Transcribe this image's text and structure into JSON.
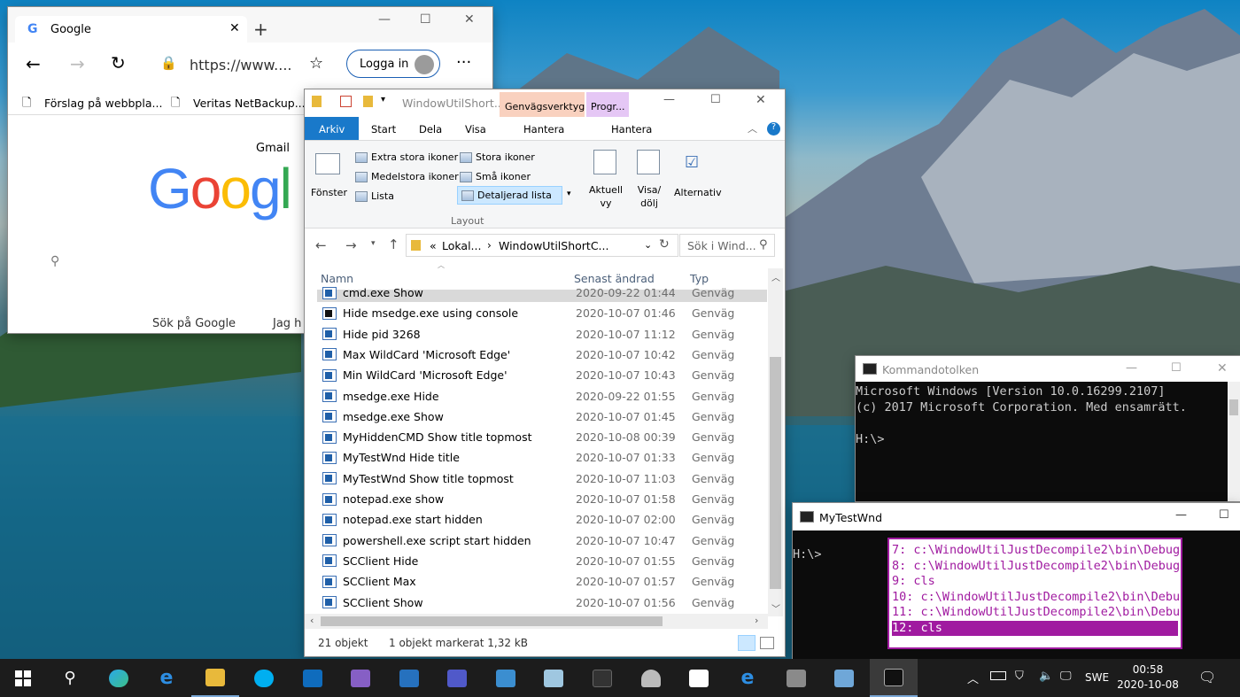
{
  "edge": {
    "tab_title": "Google",
    "address": "https://www....",
    "signin": "Logga in",
    "fav1": "Förslag på webbpla...",
    "fav2": "Veritas NetBackup...",
    "gmail": "Gmail",
    "search_btn": "Sök på Google",
    "lucky_btn": "Jag h",
    "logo": "Googl"
  },
  "explorer": {
    "qat_title": "WindowUtilShort...",
    "ctx_tab1": "Genvägsverktyg",
    "ctx_tab2": "Progr...",
    "tabs": [
      "Arkiv",
      "Start",
      "Dela",
      "Visa",
      "Hantera",
      "Hantera"
    ],
    "ribbon": {
      "pane": "Fönster",
      "xl": "Extra stora ikoner",
      "large": "Stora ikoner",
      "medium": "Medelstora ikoner",
      "small": "Små ikoner",
      "list": "Lista",
      "details": "Detaljerad lista",
      "group": "Layout",
      "current": "Aktuell vy",
      "showhide": "Visa/ dölj",
      "options": "Alternativ"
    },
    "crumb1": "Lokal...",
    "crumb2": "WindowUtilShortC...",
    "crumb_prefix": "«",
    "search_ph": "Sök i Wind...",
    "headers": {
      "name": "Namn",
      "date": "Senast ändrad",
      "type": "Typ"
    },
    "rows": [
      {
        "name": "cmd.exe Show",
        "date": "2020-09-22 01:44",
        "type": "Genväg"
      },
      {
        "name": "Hide msedge.exe using console",
        "date": "2020-10-07 01:46",
        "type": "Genväg"
      },
      {
        "name": "Hide pid 3268",
        "date": "2020-10-07 11:12",
        "type": "Genväg"
      },
      {
        "name": "Max WildCard 'Microsoft Edge'",
        "date": "2020-10-07 10:42",
        "type": "Genväg"
      },
      {
        "name": "Min WildCard 'Microsoft Edge'",
        "date": "2020-10-07 10:43",
        "type": "Genväg"
      },
      {
        "name": "msedge.exe Hide",
        "date": "2020-09-22 01:55",
        "type": "Genväg"
      },
      {
        "name": "msedge.exe Show",
        "date": "2020-10-07 01:45",
        "type": "Genväg"
      },
      {
        "name": "MyHiddenCMD Show title topmost",
        "date": "2020-10-08 00:39",
        "type": "Genväg"
      },
      {
        "name": "MyTestWnd Hide title",
        "date": "2020-10-07 01:33",
        "type": "Genväg"
      },
      {
        "name": "MyTestWnd Show title topmost",
        "date": "2020-10-07 11:03",
        "type": "Genväg"
      },
      {
        "name": "notepad.exe show",
        "date": "2020-10-07 01:58",
        "type": "Genväg"
      },
      {
        "name": "notepad.exe start hidden",
        "date": "2020-10-07 02:00",
        "type": "Genväg"
      },
      {
        "name": "powershell.exe script start hidden",
        "date": "2020-10-07 10:47",
        "type": "Genväg"
      },
      {
        "name": "SCClient Hide",
        "date": "2020-10-07 01:55",
        "type": "Genväg"
      },
      {
        "name": "SCClient Max",
        "date": "2020-10-07 01:57",
        "type": "Genväg"
      },
      {
        "name": "SCClient Show",
        "date": "2020-10-07 01:56",
        "type": "Genväg"
      }
    ],
    "status_count": "21 objekt",
    "status_sel": "1 objekt markerat  1,32 kB"
  },
  "cmd": {
    "title": "Kommandotolken",
    "line1": "Microsoft Windows [Version 10.0.16299.2107]",
    "line2": "(c) 2017 Microsoft Corporation. Med ensamrätt.",
    "prompt": "H:\\>"
  },
  "mytest": {
    "title": "MyTestWnd",
    "prompt": "H:\\>",
    "history": [
      "7: c:\\WindowUtilJustDecompile2\\bin\\Debug",
      "8: c:\\WindowUtilJustDecompile2\\bin\\Debug",
      "9: cls",
      "10: c:\\WindowUtilJustDecompile2\\bin\\Debu",
      "11: c:\\WindowUtilJustDecompile2\\bin\\Debu",
      "12: cls"
    ]
  },
  "taskbar": {
    "time": "00:58",
    "date": "2020-10-08",
    "lang": "SWE"
  },
  "colors": {
    "selected_history": "#a01aa0",
    "ribbon_accent": "#1979ca",
    "ctx1": "#f9d1bf",
    "ctx2": "#e5c7f5"
  }
}
